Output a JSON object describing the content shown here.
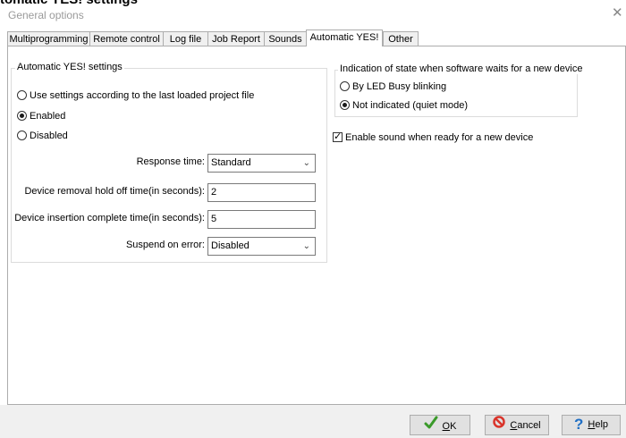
{
  "top_title": "tomatic YES! settings",
  "window": {
    "title": "General options",
    "close_glyph": "✕"
  },
  "tabs": [
    {
      "label": "Multiprogramming"
    },
    {
      "label": "Remote control"
    },
    {
      "label": "Log file"
    },
    {
      "label": "Job Report"
    },
    {
      "label": "Sounds"
    },
    {
      "label": "Automatic YES!",
      "active": true
    },
    {
      "label": "Other"
    }
  ],
  "auto_yes_group": {
    "legend": "Automatic YES! settings",
    "options": [
      {
        "label": "Use settings according to the last loaded project file",
        "selected": false
      },
      {
        "label": "Enabled",
        "selected": true
      },
      {
        "label": "Disabled",
        "selected": false
      }
    ],
    "response_time": {
      "label": "Response time:",
      "value": "Standard"
    },
    "removal_hold_off": {
      "label": "Device removal hold off time(in seconds):",
      "value": "2"
    },
    "insertion_complete": {
      "label": "Device insertion complete time(in seconds):",
      "value": "5"
    },
    "suspend_on_error": {
      "label": "Suspend on error:",
      "value": "Disabled"
    }
  },
  "indication_group": {
    "legend": "Indication of state when software waits for a new device",
    "options": [
      {
        "label": "By LED Busy blinking",
        "selected": false
      },
      {
        "label": "Not indicated (quiet mode)",
        "selected": true
      }
    ]
  },
  "sound_checkbox": {
    "label": "Enable sound when ready for a new device",
    "checked": true
  },
  "buttons": {
    "ok": {
      "mnemonic": "O",
      "rest": "K",
      "icon": "checkmark-icon",
      "color": "#3a9a2a"
    },
    "cancel": {
      "mnemonic": "C",
      "rest": "ancel",
      "icon": "cancel-icon",
      "color": "#d9342b"
    },
    "help": {
      "mnemonic": "H",
      "rest": "elp",
      "icon": "question-icon",
      "color": "#1f6fc5"
    }
  }
}
